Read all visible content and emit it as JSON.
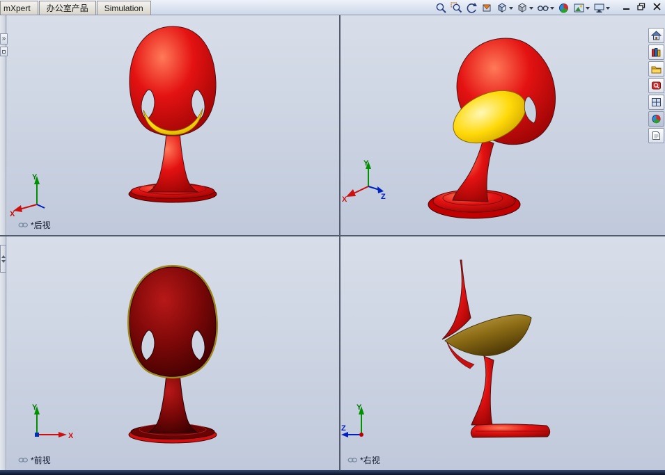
{
  "colors": {
    "viewport_bg_top": "#d8dee9",
    "viewport_bg_bottom": "#c0c9db",
    "chair_red": "#e01010",
    "chair_dark_red": "#7a0606",
    "seat_yellow": "#ffd400",
    "seat_brown": "#8a6a14",
    "axis_x": "#cc1010",
    "axis_y": "#009000",
    "axis_z": "#0020c0"
  },
  "command_tabs": {
    "items": [
      {
        "label": "mXpert"
      },
      {
        "label": "办公室产品"
      },
      {
        "label": "Simulation"
      }
    ]
  },
  "heads_up_toolbar": {
    "icons": [
      {
        "name": "zoom-to-fit",
        "dropdown": false
      },
      {
        "name": "zoom-to-area",
        "dropdown": false
      },
      {
        "name": "previous-view",
        "dropdown": false
      },
      {
        "name": "section-view",
        "dropdown": false
      },
      {
        "name": "view-orientation",
        "dropdown": true
      },
      {
        "name": "display-style",
        "dropdown": true
      },
      {
        "name": "hide-show-items",
        "dropdown": true
      },
      {
        "name": "edit-appearance",
        "dropdown": false
      },
      {
        "name": "apply-scene",
        "dropdown": true
      },
      {
        "name": "view-settings",
        "dropdown": true
      }
    ]
  },
  "window_controls": {
    "buttons": [
      "minimize",
      "restore",
      "close"
    ]
  },
  "task_pane": {
    "icons": [
      "solidworks-resources",
      "design-library",
      "file-explorer",
      "solidworks-search",
      "view-palette",
      "appearances-scenes",
      "custom-properties"
    ]
  },
  "left_edge": {
    "flyout_glyph": "»"
  },
  "viewports": {
    "back": {
      "label": "*后视"
    },
    "iso": {
      "label": ""
    },
    "front": {
      "label": "*前视"
    },
    "right": {
      "label": "*右视"
    }
  },
  "axes": {
    "x": "X",
    "y": "Y",
    "z": "Z"
  }
}
